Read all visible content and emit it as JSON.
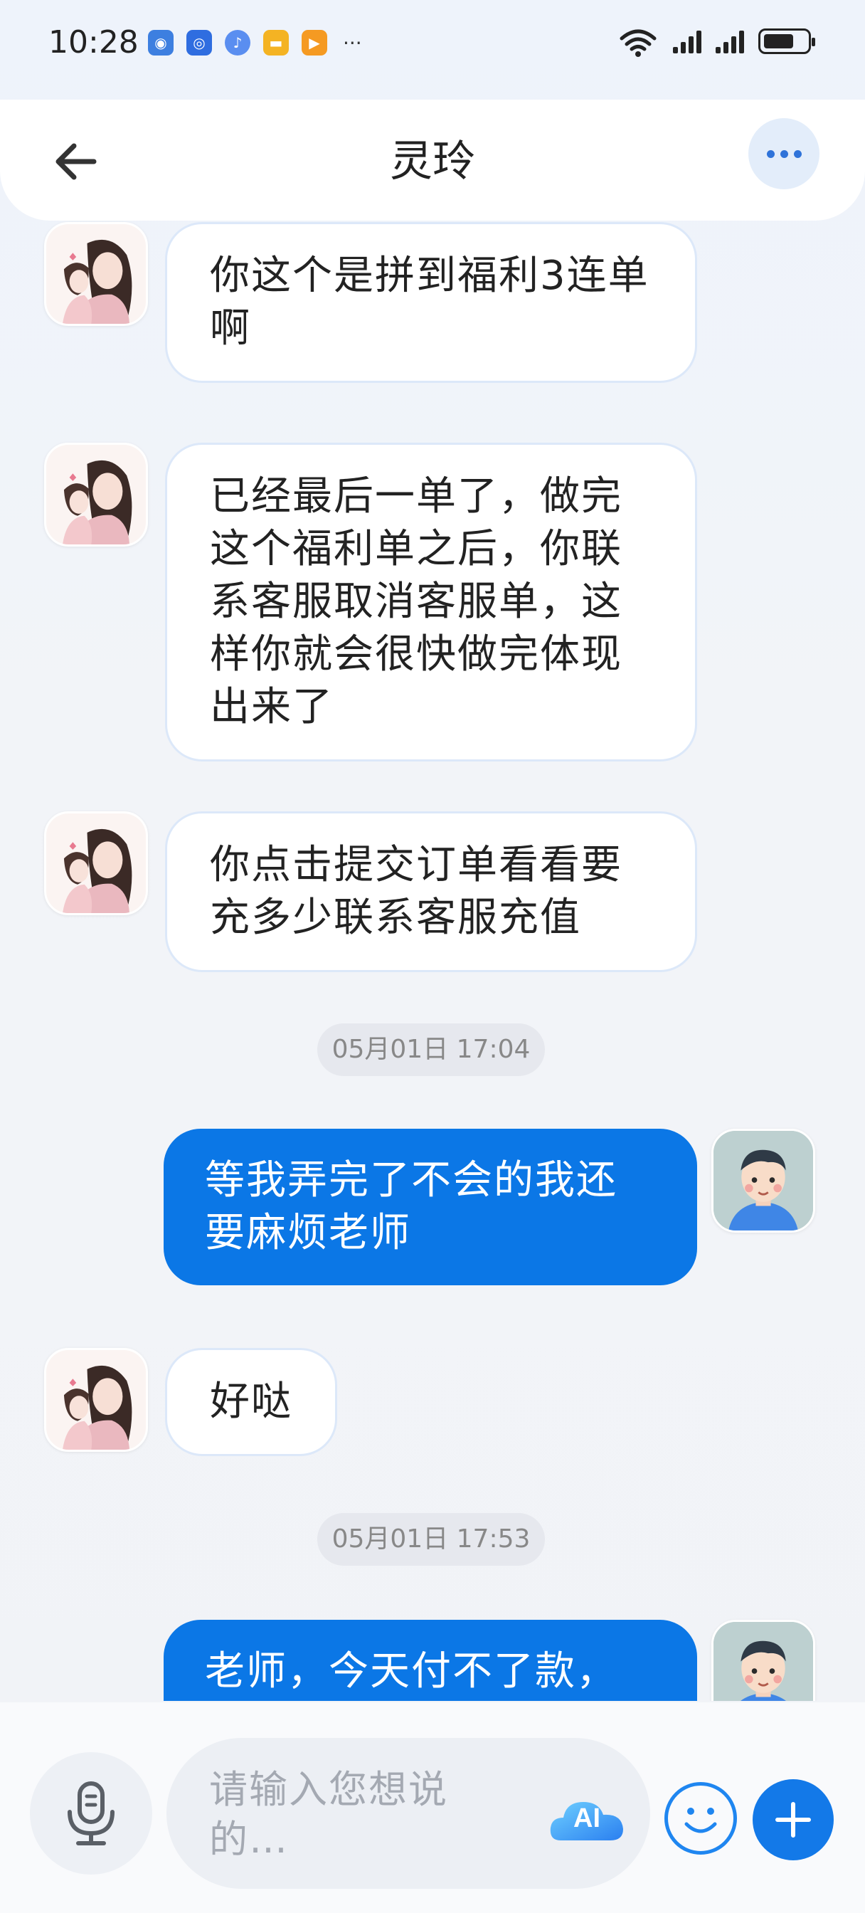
{
  "status_bar": {
    "time": "10:28",
    "battery_level": 0.7
  },
  "header": {
    "title": "灵玲"
  },
  "messages": [
    {
      "side": "in",
      "text": "你这个是拼到福利3连单啊"
    },
    {
      "side": "in",
      "text": "已经最后一单了，做完这个福利单之后，你联系客服取消客服单，这样你就会很快做完体现出来了"
    },
    {
      "side": "in",
      "text": "你点击提交订单看看要充多少联系客服充值"
    },
    {
      "type": "timestamp",
      "text": "05月01日 17:04"
    },
    {
      "side": "out",
      "text": "等我弄完了不会的我还要麻烦老师"
    },
    {
      "side": "in",
      "text": "好哒"
    },
    {
      "type": "timestamp",
      "text": "05月01日 17:53"
    },
    {
      "side": "out",
      "text": "老师，今天付不了款，"
    }
  ],
  "input": {
    "placeholder": "请输入您想说的…",
    "ai_label": "AI"
  },
  "colors": {
    "accent": "#0b77e6",
    "bubble_in": "#ffffff",
    "timestamp_bg": "#e6e8ee"
  },
  "icons": [
    "back-arrow-icon",
    "more-icon",
    "microphone-icon",
    "ai-icon",
    "emoji-icon",
    "plus-icon"
  ]
}
